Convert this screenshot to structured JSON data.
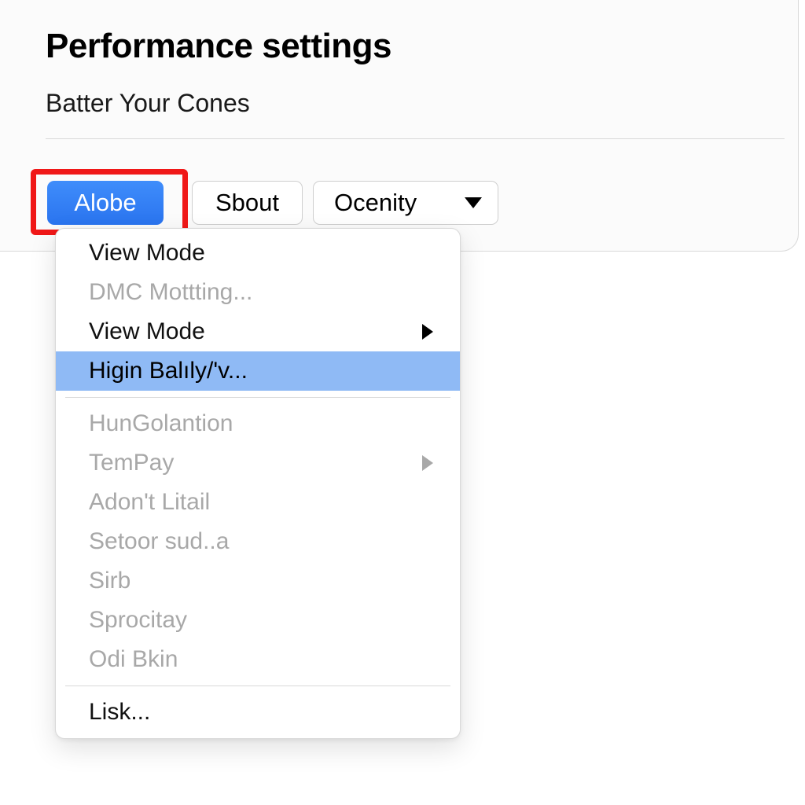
{
  "header": {
    "title": "Performance settings",
    "subtitle": "Batter Your Cones"
  },
  "toolbar": {
    "primary_button": "Alobe",
    "secondary_button": "Sbout",
    "dropdown_label": "Ocenity"
  },
  "menu": {
    "items": [
      {
        "label": "View Mode",
        "enabled": true,
        "submenu": false,
        "highlighted": false
      },
      {
        "label": "DMC Mottting...",
        "enabled": false,
        "submenu": false,
        "highlighted": false
      },
      {
        "label": "View Mode",
        "enabled": true,
        "submenu": true,
        "highlighted": false
      },
      {
        "label": "Higin Balıly/'v...",
        "enabled": true,
        "submenu": false,
        "highlighted": true
      }
    ],
    "items_group2": [
      {
        "label": "HunGolantion",
        "enabled": false,
        "submenu": false
      },
      {
        "label": "TemPay",
        "enabled": false,
        "submenu": true
      },
      {
        "label": "Adon't Litail",
        "enabled": false,
        "submenu": false
      },
      {
        "label": "Setoor sud..a",
        "enabled": false,
        "submenu": false
      },
      {
        "label": "Sirb",
        "enabled": false,
        "submenu": false
      },
      {
        "label": "Sprocitay",
        "enabled": false,
        "submenu": false
      },
      {
        "label": "Odi Bkin",
        "enabled": false,
        "submenu": false
      }
    ],
    "items_group3": [
      {
        "label": "Lisk...",
        "enabled": true,
        "submenu": false
      }
    ]
  },
  "colors": {
    "accent_blue": "#2f7df6",
    "menu_highlight": "#8fbaf5",
    "highlight_red": "#f01818"
  }
}
